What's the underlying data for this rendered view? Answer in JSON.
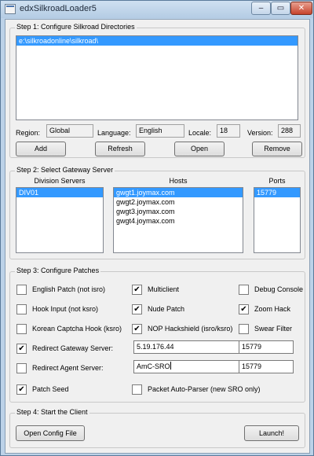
{
  "window": {
    "title": "edxSilkroadLoader5",
    "minimize": "–",
    "maximize": "▭",
    "close": "✕"
  },
  "step1": {
    "title": "Step 1: Configure Silkroad Directories",
    "directories": [
      "e:\\silkroadonline\\silkroad\\"
    ],
    "region_label": "Region:",
    "region_value": "Global",
    "language_label": "Language:",
    "language_value": "English",
    "locale_label": "Locale:",
    "locale_value": "18",
    "version_label": "Version:",
    "version_value": "288",
    "add_label": "Add",
    "refresh_label": "Refresh",
    "open_label": "Open",
    "remove_label": "Remove"
  },
  "step2": {
    "title": "Step 2: Select Gateway Server",
    "division_header": "Division Servers",
    "hosts_header": "Hosts",
    "ports_header": "Ports",
    "divisions": [
      "DIV01"
    ],
    "hosts": [
      "gwgt1.joymax.com",
      "gwgt2.joymax.com",
      "gwgt3.joymax.com",
      "gwgt4.joymax.com"
    ],
    "ports": [
      "15779"
    ]
  },
  "step3": {
    "title": "Step 3: Configure Patches",
    "english_patch": {
      "label": "English Patch (not isro)",
      "checked": false
    },
    "multiclient": {
      "label": "Multiclient",
      "checked": true
    },
    "debug_console": {
      "label": "Debug Console",
      "checked": false
    },
    "hook_input": {
      "label": "Hook Input (not ksro)",
      "checked": false
    },
    "nude_patch": {
      "label": "Nude Patch",
      "checked": true
    },
    "zoom_hack": {
      "label": "Zoom Hack",
      "checked": true
    },
    "korean_captcha": {
      "label": "Korean Captcha Hook (ksro)",
      "checked": false
    },
    "nop_hackshield": {
      "label": "NOP Hackshield (isro/ksro)",
      "checked": true
    },
    "swear_filter": {
      "label": "Swear Filter",
      "checked": false
    },
    "redirect_gateway": {
      "label": "Redirect Gateway Server:",
      "checked": true,
      "ip": "5.19.176.44",
      "port": "15779"
    },
    "redirect_agent": {
      "label": "Redirect Agent Server:",
      "checked": false,
      "ip": "AmC-SRO",
      "port": "15779"
    },
    "patch_seed": {
      "label": "Patch Seed",
      "checked": true
    },
    "packet_parser": {
      "label": "Packet Auto-Parser (new SRO only)",
      "checked": false
    }
  },
  "step4": {
    "title": "Step 4: Start the Client",
    "open_config_label": "Open Config File",
    "launch_label": "Launch!"
  },
  "check_mark": "✔"
}
